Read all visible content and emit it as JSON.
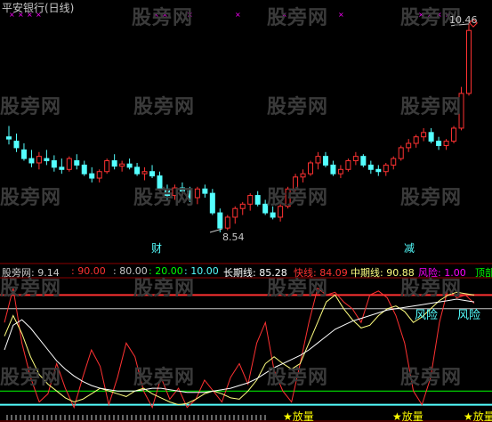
{
  "header": {
    "title": "平安银行(日线)"
  },
  "watermark": "股旁网",
  "price_labels": {
    "high": "10.46",
    "low": "8.54"
  },
  "markers": {
    "cai": "财",
    "jian": "减"
  },
  "indicator_bar": {
    "name": "股旁网",
    "value": ": 9.14",
    "lvl90": ": 90.00",
    "lvl80": ": 80.00",
    "lvl20": ": 20.00",
    "lvl10": ": 10.00",
    "long_label": "长期线",
    "long_value": ": 85.28",
    "fast_label": "快线",
    "fast_value": ": 84.09",
    "mid_label": "中期线",
    "mid_value": ": 90.88",
    "risk_label": "风险",
    "risk_value": ": 1.00",
    "top_label": "顶部"
  },
  "risk_labels": [
    "风险",
    "风险"
  ],
  "signal_labels": [
    "放量",
    "放量",
    "放量"
  ],
  "colors": {
    "up": "#ff3232",
    "down": "#54ffff",
    "yellow": "#ffff00",
    "magenta": "#ff00ff",
    "green": "#00ff00"
  },
  "chart_data": {
    "type": "candlestick",
    "ohlc": [
      [
        9.42,
        9.52,
        9.35,
        9.4
      ],
      [
        9.38,
        9.45,
        9.28,
        9.32
      ],
      [
        9.3,
        9.36,
        9.2,
        9.22
      ],
      [
        9.22,
        9.3,
        9.14,
        9.18
      ],
      [
        9.18,
        9.28,
        9.12,
        9.24
      ],
      [
        9.22,
        9.3,
        9.16,
        9.2
      ],
      [
        9.2,
        9.25,
        9.1,
        9.14
      ],
      [
        9.14,
        9.22,
        9.08,
        9.12
      ],
      [
        9.12,
        9.24,
        9.1,
        9.22
      ],
      [
        9.2,
        9.26,
        9.12,
        9.16
      ],
      [
        9.16,
        9.2,
        9.06,
        9.08
      ],
      [
        9.08,
        9.14,
        9.0,
        9.04
      ],
      [
        9.04,
        9.12,
        9.0,
        9.1
      ],
      [
        9.1,
        9.22,
        9.08,
        9.2
      ],
      [
        9.2,
        9.26,
        9.12,
        9.15
      ],
      [
        9.15,
        9.2,
        9.1,
        9.17
      ],
      [
        9.17,
        9.22,
        9.12,
        9.14
      ],
      [
        9.14,
        9.18,
        9.06,
        9.08
      ],
      [
        9.08,
        9.14,
        9.02,
        9.1
      ],
      [
        9.1,
        9.16,
        9.04,
        9.06
      ],
      [
        9.06,
        9.1,
        8.92,
        8.94
      ],
      [
        8.94,
        8.98,
        8.84,
        8.88
      ],
      [
        8.88,
        8.98,
        8.84,
        8.95
      ],
      [
        8.95,
        9.0,
        8.88,
        8.92
      ],
      [
        8.92,
        8.96,
        8.82,
        8.86
      ],
      [
        8.86,
        8.96,
        8.8,
        8.94
      ],
      [
        8.94,
        8.98,
        8.86,
        8.9
      ],
      [
        8.9,
        8.94,
        8.7,
        8.72
      ],
      [
        8.72,
        8.76,
        8.54,
        8.58
      ],
      [
        8.58,
        8.7,
        8.56,
        8.68
      ],
      [
        8.68,
        8.78,
        8.62,
        8.76
      ],
      [
        8.76,
        8.82,
        8.7,
        8.8
      ],
      [
        8.8,
        8.9,
        8.74,
        8.88
      ],
      [
        8.88,
        8.92,
        8.78,
        8.8
      ],
      [
        8.8,
        8.84,
        8.7,
        8.72
      ],
      [
        8.72,
        8.78,
        8.66,
        8.68
      ],
      [
        8.68,
        8.8,
        8.64,
        8.78
      ],
      [
        8.78,
        8.96,
        8.76,
        8.94
      ],
      [
        8.94,
        9.08,
        8.92,
        9.05
      ],
      [
        9.05,
        9.12,
        9.0,
        9.08
      ],
      [
        9.08,
        9.2,
        9.06,
        9.18
      ],
      [
        9.18,
        9.28,
        9.12,
        9.24
      ],
      [
        9.24,
        9.28,
        9.14,
        9.16
      ],
      [
        9.16,
        9.2,
        9.06,
        9.08
      ],
      [
        9.08,
        9.16,
        9.04,
        9.12
      ],
      [
        9.12,
        9.22,
        9.1,
        9.2
      ],
      [
        9.2,
        9.28,
        9.16,
        9.24
      ],
      [
        9.24,
        9.26,
        9.14,
        9.16
      ],
      [
        9.16,
        9.2,
        9.08,
        9.12
      ],
      [
        9.12,
        9.16,
        9.06,
        9.1
      ],
      [
        9.1,
        9.18,
        9.06,
        9.16
      ],
      [
        9.16,
        9.24,
        9.12,
        9.22
      ],
      [
        9.22,
        9.34,
        9.2,
        9.32
      ],
      [
        9.32,
        9.4,
        9.28,
        9.36
      ],
      [
        9.36,
        9.44,
        9.32,
        9.42
      ],
      [
        9.42,
        9.5,
        9.38,
        9.46
      ],
      [
        9.46,
        9.5,
        9.36,
        9.38
      ],
      [
        9.38,
        9.42,
        9.3,
        9.34
      ],
      [
        9.34,
        9.4,
        9.3,
        9.38
      ],
      [
        9.38,
        9.52,
        9.36,
        9.5
      ],
      [
        9.5,
        9.88,
        9.48,
        9.82
      ],
      [
        9.82,
        10.46,
        9.8,
        10.4
      ]
    ],
    "ylim": [
      8.45,
      10.5
    ]
  }
}
